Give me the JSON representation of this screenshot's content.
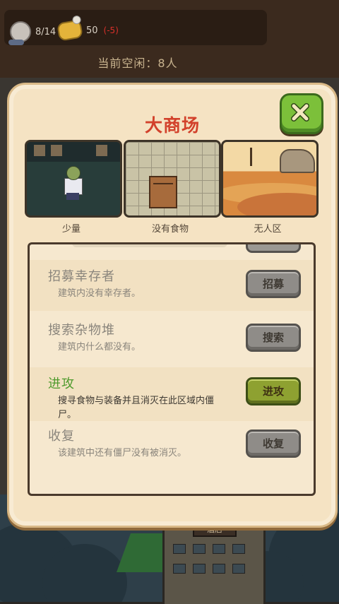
{
  "hud": {
    "survivors": "8/14",
    "food": "50",
    "food_change": "(-5)",
    "idle_text": "当前空闲：8人"
  },
  "dialog": {
    "title": "大商场",
    "thumbnails": [
      {
        "label": "少量"
      },
      {
        "label": "没有食物"
      },
      {
        "label": "无人区"
      }
    ],
    "actions": [
      {
        "title": "招募幸存者",
        "desc": "建筑内没有幸存者。",
        "button": "招募",
        "enabled": false
      },
      {
        "title": "搜索杂物堆",
        "desc": "建筑内什么都没有。",
        "button": "搜索",
        "enabled": false
      },
      {
        "title": "进攻",
        "desc": "搜寻食物与装备并且消灭在此区域内僵尸。",
        "button": "进攻",
        "enabled": true
      },
      {
        "title": "收复",
        "desc": "该建筑中还有僵尸没有被消灭。",
        "button": "收复",
        "enabled": false
      }
    ]
  },
  "background": {
    "sign_text": "酒店"
  },
  "colors": {
    "title": "#d2412b",
    "active_action": "#4e9a2c",
    "close_button": "#7cc03a",
    "food_negative": "#d9302a"
  },
  "icons": [
    "survivor-icon",
    "food-icon",
    "close-icon"
  ]
}
